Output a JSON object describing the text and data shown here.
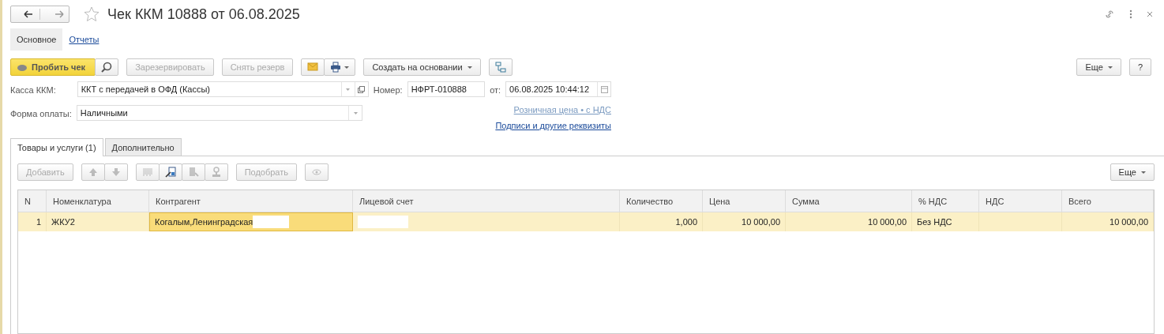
{
  "window": {
    "title": "Чек ККМ 10888 от 06.08.2025",
    "favorite": false
  },
  "sections": [
    {
      "label": "Основное",
      "selected": true
    },
    {
      "label": "Отчеты",
      "selected": false
    }
  ],
  "toolbar": [
    {
      "kind": "primary",
      "label": "Пробить чек",
      "disabled": false
    },
    {
      "kind": "icon",
      "disabled": false
    },
    {
      "kind": "text",
      "label": "Зарезервировать",
      "disabled": true
    },
    {
      "kind": "text",
      "label": "Снять резерв",
      "disabled": true
    },
    {
      "kind": "icon",
      "disabled": false
    },
    {
      "kind": "menu-icon",
      "disabled": false
    },
    {
      "kind": "menu",
      "label": "Создать на основании",
      "disabled": false
    },
    {
      "kind": "icon",
      "disabled": false
    }
  ],
  "toolbar_right": [
    {
      "kind": "menu",
      "label": "Еще",
      "disabled": false
    },
    {
      "kind": "text",
      "label": "?",
      "disabled": false
    }
  ],
  "kassa": {
    "label": "Касса ККМ:",
    "value": "ККТ с передачей в ОФД (Кассы)"
  },
  "number": {
    "label": "Номер:",
    "value": "НФРТ-010888"
  },
  "date": {
    "label": "от:",
    "value": "06.08.2025 10:44:12"
  },
  "payment": {
    "label": "Форма оплаты:",
    "value": "Наличными"
  },
  "links": [
    {
      "label": "Розничная цена • с НДС",
      "disabled": true
    },
    {
      "label": "Подписи и другие реквизиты",
      "disabled": false
    }
  ],
  "tabs": [
    {
      "label": "Товары и услуги (1)",
      "selected": true
    },
    {
      "label": "Дополнительно",
      "selected": false
    }
  ],
  "table_toolbar": [
    {
      "kind": "text",
      "label": "Добавить",
      "disabled": true
    },
    {
      "kind": "icon",
      "disabled": true
    },
    {
      "kind": "icon",
      "disabled": true
    },
    {
      "kind": "icon",
      "disabled": true
    },
    {
      "kind": "icon",
      "disabled": false
    },
    {
      "kind": "icon",
      "disabled": true
    },
    {
      "kind": "icon",
      "disabled": true
    },
    {
      "kind": "text",
      "label": "Подобрать",
      "disabled": true
    },
    {
      "kind": "icon",
      "disabled": true
    }
  ],
  "table_more": {
    "label": "Еще"
  },
  "table": {
    "columns": [
      {
        "label": "N"
      },
      {
        "label": "Номенклатура"
      },
      {
        "label": "Контрагент"
      },
      {
        "label": "Лицевой счет"
      },
      {
        "label": "Количество"
      },
      {
        "label": "Цена"
      },
      {
        "label": "Сумма"
      },
      {
        "label": "% НДС"
      },
      {
        "label": "НДС"
      },
      {
        "label": "Всего"
      }
    ],
    "rows": [
      {
        "selected": true,
        "cells": [
          {
            "text": "1",
            "active": false,
            "redacted": false
          },
          {
            "text": "ЖКУ2",
            "active": false,
            "redacted": false
          },
          {
            "text": "Когалым,Ленинградская",
            "active": true,
            "redacted": true
          },
          {
            "active": false,
            "redacted": true
          },
          {
            "text": "1,000",
            "active": false,
            "redacted": false
          },
          {
            "text": "10 000,00",
            "active": false,
            "redacted": false
          },
          {
            "text": "10 000,00",
            "active": false,
            "redacted": false
          },
          {
            "text": "Без НДС",
            "active": false,
            "redacted": false
          },
          {
            "active": false,
            "redacted": false
          },
          {
            "text": "10 000,00",
            "active": false,
            "redacted": false
          }
        ]
      }
    ]
  }
}
